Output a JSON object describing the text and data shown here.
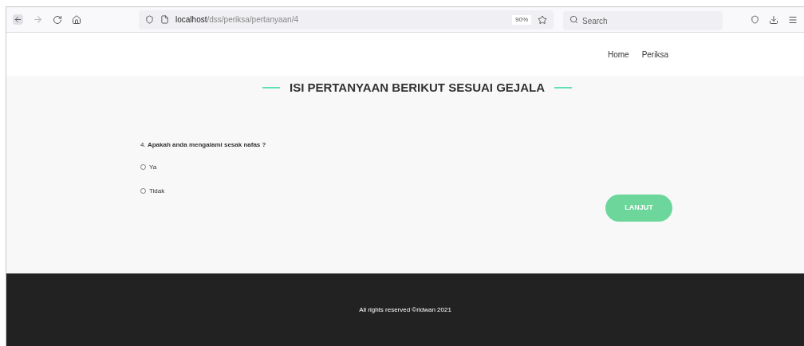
{
  "browser": {
    "url_host": "localhost",
    "url_path": "/dss/periksa/pertanyaan/4",
    "zoom": "90%",
    "search": {
      "placeholder": "Search"
    }
  },
  "nav": {
    "items": [
      {
        "label": "Home"
      },
      {
        "label": "Periksa"
      }
    ]
  },
  "title": "ISI PERTANYAAN BERIKUT SESUAI GEJALA",
  "question": {
    "text": "4. **Apakah anda mengalami sesak nafas ?**",
    "options": [
      {
        "label": "Ya",
        "selected": false
      },
      {
        "label": "Tidak",
        "selected": false
      }
    ]
  },
  "submit_button": "LANJUT",
  "footer": "All rights reserved ©ridwan 2021"
}
